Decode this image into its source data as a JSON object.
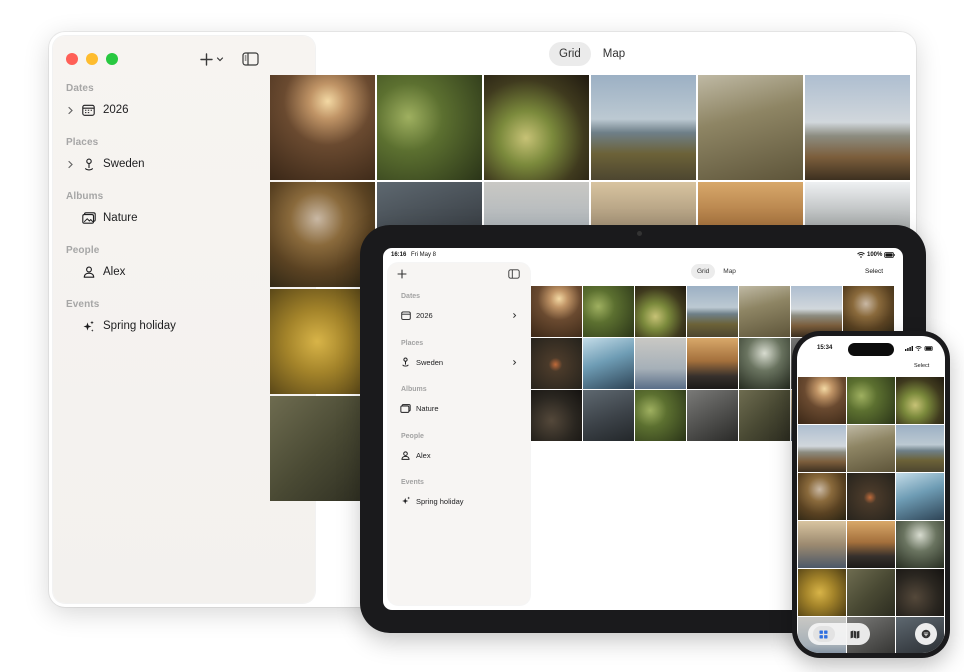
{
  "sidebar": {
    "sections": [
      {
        "label": "Dates",
        "item": "2026"
      },
      {
        "label": "Places",
        "item": "Sweden"
      },
      {
        "label": "Albums",
        "item": "Nature"
      },
      {
        "label": "People",
        "item": "Alex"
      },
      {
        "label": "Events",
        "item": "Spring holiday"
      }
    ]
  },
  "view_modes": [
    "Grid",
    "Map"
  ],
  "selected_view": "Grid",
  "ipad": {
    "status_time": "16:16",
    "status_date": "Fri May 8",
    "battery": "100%",
    "select_label": "Select"
  },
  "iphone": {
    "status_time": "15:34",
    "select_label": "Select"
  },
  "colors": {
    "sidebar_bg": "#f6f4f2",
    "segment_active": "#ebebeb",
    "close": "#ff5f57",
    "minimize": "#febc2e",
    "zoom": "#28c840"
  }
}
